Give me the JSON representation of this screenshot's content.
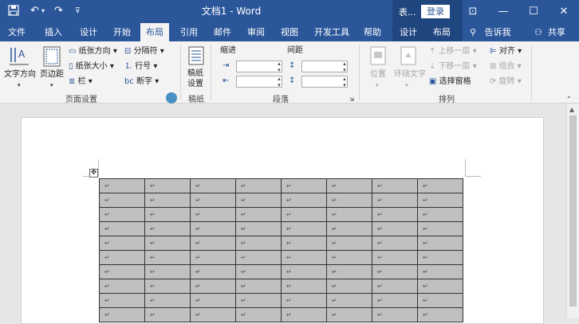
{
  "titlebar": {
    "title": "文档1 - Word",
    "context_title": "表...",
    "login": "登录",
    "icons": [
      "save-icon",
      "undo-icon",
      "redo-icon",
      "customize-icon",
      "ribbon-display-icon",
      "minimize-icon",
      "maximize-icon",
      "close-icon"
    ]
  },
  "tabs": [
    "文件",
    "插入",
    "设计",
    "开始",
    "布局",
    "引用",
    "邮件",
    "审阅",
    "视图",
    "开发工具",
    "帮助",
    "设计",
    "布局"
  ],
  "active_tab": "布局",
  "tellme": "告诉我",
  "share": "共享",
  "ribbon": {
    "page_setup": {
      "text_direction": "文字方向",
      "margins": "页边距",
      "orientation": "纸张方向",
      "size": "纸张大小",
      "columns": "栏",
      "breaks": "分隔符",
      "line_numbers": "行号",
      "hyphenation": "断字",
      "label": "页面设置"
    },
    "manuscript": {
      "button": "稿纸设置",
      "label": "稿纸"
    },
    "paragraph": {
      "indent": "缩进",
      "spacing": "间距",
      "label": "段落"
    },
    "arrange": {
      "position": "位置",
      "wrap_text": "环绕文字",
      "bring_forward": "上移一层",
      "send_backward": "下移一层",
      "selection_pane": "选择窗格",
      "align": "对齐",
      "group": "组合",
      "rotate": "旋转",
      "label": "排列"
    }
  },
  "table": {
    "rows": 10,
    "cols": 8,
    "cell_mark": "↵"
  }
}
